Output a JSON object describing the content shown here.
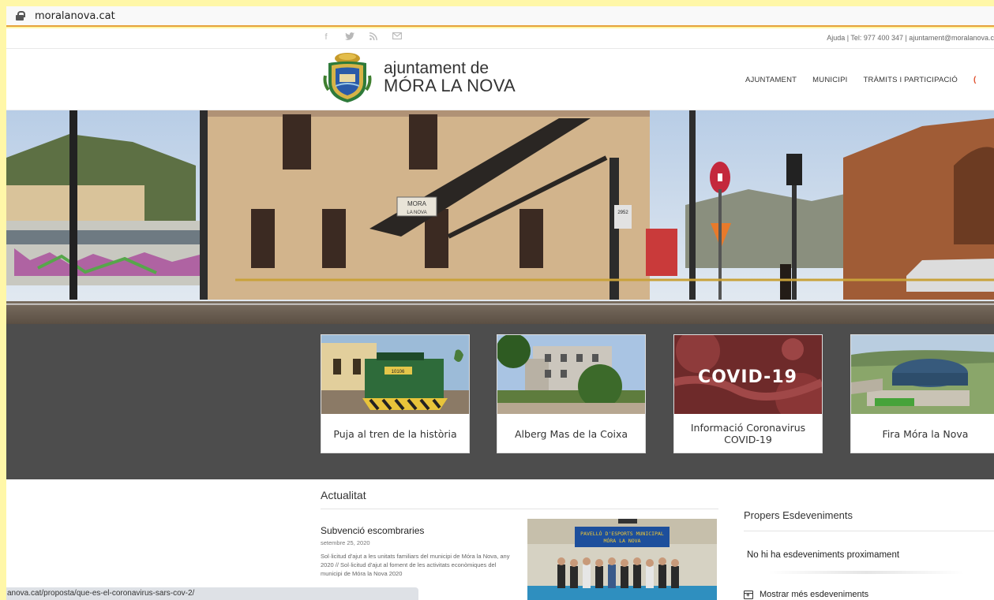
{
  "browser": {
    "url": "moralanova.cat",
    "status_url": "anova.cat/proposta/que-es-el-coronavirus-sars-cov-2/"
  },
  "topbar": {
    "social_icons": [
      "facebook-icon",
      "twitter-icon",
      "rss-icon",
      "email-icon"
    ],
    "contact": "Ajuda | Tel: 977 400 347  |  ajuntament@moralanova.c"
  },
  "header": {
    "brand_line1": "ajuntament de",
    "brand_line2": "MÓRA LA NOVA",
    "nav": [
      "AJUNTAMENT",
      "MUNICIPI",
      "TRÀMITS I PARTICIPACIÓ"
    ],
    "nav_more": "("
  },
  "hero": {
    "sign_line1": "MORA",
    "sign_line2": "LA NOVA",
    "post_number": "2952"
  },
  "featured": [
    {
      "title": "Puja al tren de la història",
      "loco_number": "10106"
    },
    {
      "title": "Alberg Mas de la Coixa"
    },
    {
      "title": "Informació Coronavirus COVID-19",
      "overlay": "COVID-19"
    },
    {
      "title": "Fira Móra la Nova"
    }
  ],
  "news": {
    "heading": "Actualitat",
    "post_title": "Subvenció escombraries",
    "post_date": "setembre 25, 2020",
    "post_excerpt": "Sol·licitud d'ajut a les unitats familiars del municipi de Móra la Nova, any 2020  // Sol·licitud d'ajut al foment de les activitats econòmiques del municipi de Móra la Nova 2020",
    "image_banner_line1": "PAVELLÓ D'ESPORTS MUNICIPAL",
    "image_banner_line2": "MÓRA LA NOVA"
  },
  "events": {
    "heading": "Propers Esdeveniments",
    "empty": "No hi ha esdeveniments proximament",
    "more": "Mostrar més esdeveniments"
  },
  "colors": {
    "page_bg": "#fff7a8",
    "featured_bg": "#4d4d4d",
    "accent": "#e04e2b",
    "address_underline": "#e6a23c"
  }
}
